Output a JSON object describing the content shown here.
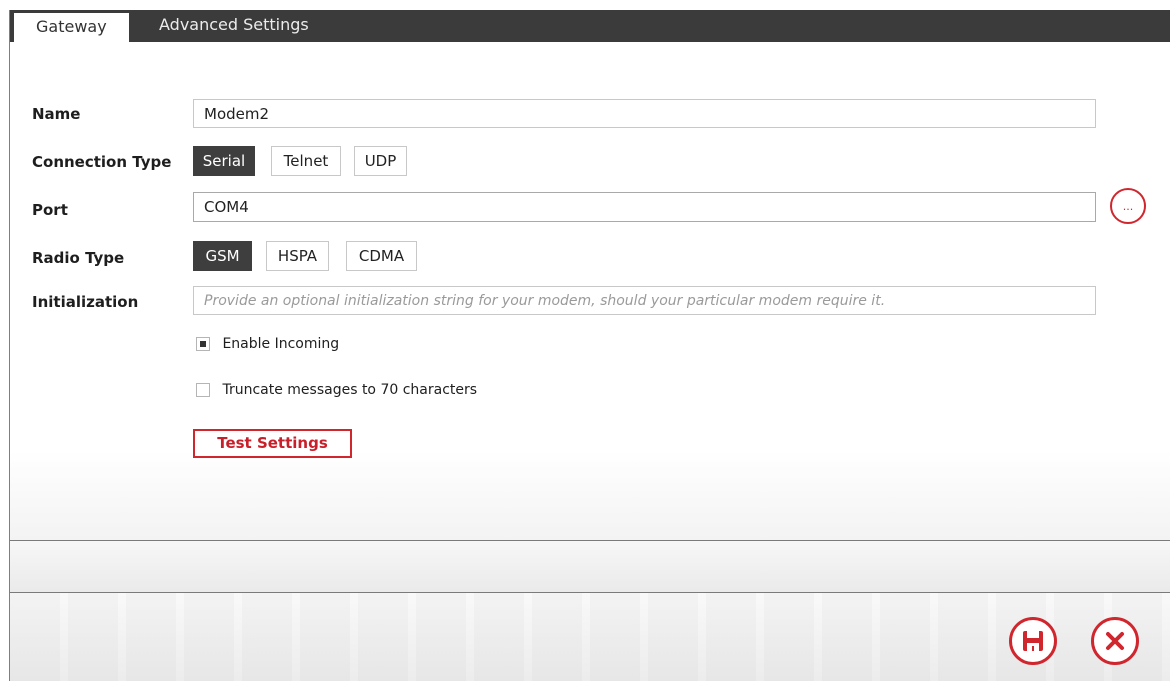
{
  "tabs": {
    "gateway_label": "Gateway",
    "advanced_label": "Advanced Settings"
  },
  "form": {
    "name_label": "Name",
    "name_value": "Modem2",
    "connection_type_label": "Connection Type",
    "connection_options": [
      "Serial",
      "Telnet",
      "UDP"
    ],
    "connection_selected": "Serial",
    "port_label": "Port",
    "port_value": "COM4",
    "browse_label": "...",
    "radio_type_label": "Radio Type",
    "radio_options": [
      "GSM",
      "HSPA",
      "CDMA"
    ],
    "radio_selected": "GSM",
    "initialization_label": "Initialization",
    "initialization_value": "",
    "initialization_placeholder": "Provide an optional initialization string for your modem, should your particular modem require it.",
    "enable_incoming_label": "Enable Incoming",
    "enable_incoming_checked": true,
    "truncate_label": "Truncate messages to 70 characters",
    "truncate_checked": false,
    "test_button_label": "Test Settings"
  },
  "footer": {
    "save_icon": "save-icon",
    "cancel_icon": "close-icon"
  },
  "colors": {
    "accent": "#d0262e",
    "selected_segment": "#3e3e3e",
    "tabbar": "#3b3b3b"
  }
}
